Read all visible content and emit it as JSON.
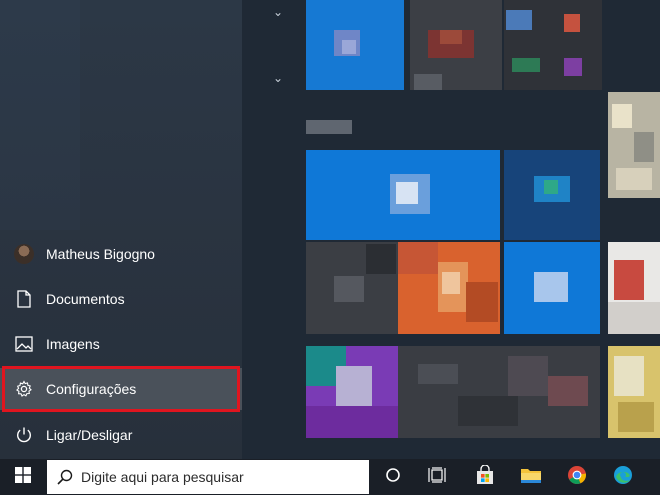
{
  "user": {
    "name": "Matheus Bigogno"
  },
  "menu": {
    "documents": "Documentos",
    "images": "Imagens",
    "settings": "Configurações",
    "power": "Ligar/Desligar"
  },
  "taskbar": {
    "search_placeholder": "Digite aqui para pesquisar",
    "icons": [
      "windows-icon",
      "search-icon",
      "cortana-icon",
      "task-view-icon",
      "store-icon",
      "file-explorer-icon",
      "chrome-icon",
      "edge-icon"
    ]
  },
  "colors": {
    "accent_blue": "#0f78d7",
    "highlight": "#4a515a",
    "annotation_red": "#e0151f"
  }
}
